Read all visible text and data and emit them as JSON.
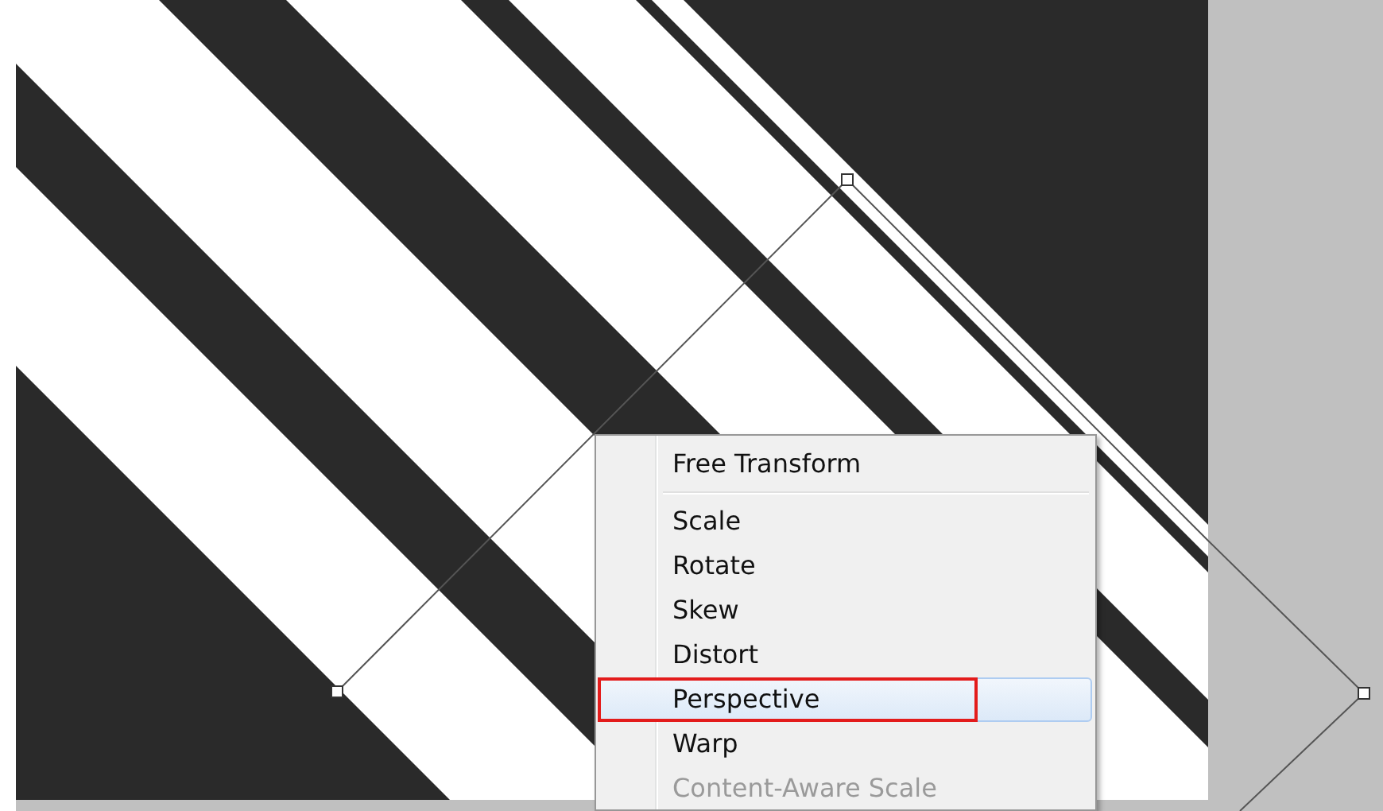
{
  "context_menu": {
    "items": [
      {
        "label": "Free Transform",
        "kind": "item",
        "selected": false,
        "disabled": false,
        "separator_after": true
      },
      {
        "label": "Scale",
        "kind": "item",
        "selected": false,
        "disabled": false,
        "separator_after": false
      },
      {
        "label": "Rotate",
        "kind": "item",
        "selected": false,
        "disabled": false,
        "separator_after": false
      },
      {
        "label": "Skew",
        "kind": "item",
        "selected": false,
        "disabled": false,
        "separator_after": false
      },
      {
        "label": "Distort",
        "kind": "item",
        "selected": false,
        "disabled": false,
        "separator_after": false
      },
      {
        "label": "Perspective",
        "kind": "item",
        "selected": true,
        "disabled": false,
        "separator_after": false
      },
      {
        "label": "Warp",
        "kind": "item",
        "selected": false,
        "disabled": false,
        "separator_after": false
      },
      {
        "label": "Content-Aware Scale",
        "kind": "item",
        "selected": false,
        "disabled": true,
        "separator_after": false
      }
    ]
  }
}
